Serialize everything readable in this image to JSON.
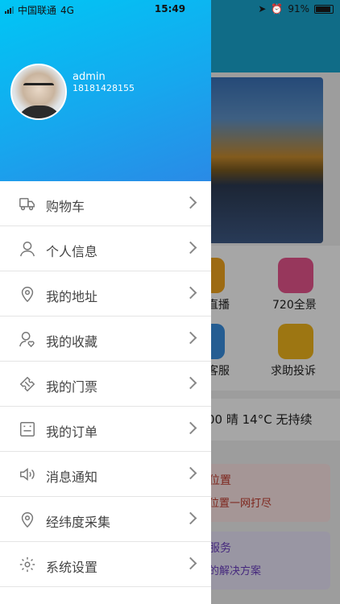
{
  "status_bar": {
    "carrier": "中国联通",
    "network": "4G",
    "time": "15:49",
    "battery": "91%",
    "battery_level": 0.91
  },
  "background": {
    "tiles": [
      "直播",
      "720全景",
      "客服",
      "求助投诉"
    ],
    "weather": "00 晴 14°C 无持续",
    "card1_title": "位置",
    "card1_sub": "位置一网打尽",
    "card2_title": "服务",
    "card2_sub": "的解决方案"
  },
  "profile": {
    "username": "admin",
    "phone": "18181428155"
  },
  "menu": [
    {
      "label": "购物车",
      "icon": "truck-icon"
    },
    {
      "label": "个人信息",
      "icon": "person-icon"
    },
    {
      "label": "我的地址",
      "icon": "location-pin-icon"
    },
    {
      "label": "我的收藏",
      "icon": "person-heart-icon"
    },
    {
      "label": "我的门票",
      "icon": "ticket-icon"
    },
    {
      "label": "我的订单",
      "icon": "order-list-icon"
    },
    {
      "label": "消息通知",
      "icon": "speaker-icon"
    },
    {
      "label": "经纬度采集",
      "icon": "location-pin-icon"
    },
    {
      "label": "系统设置",
      "icon": "gear-icon"
    }
  ],
  "colors": {
    "header_start": "#00c6f5",
    "header_end": "#2a8ae6",
    "icon_stroke": "#777777"
  }
}
